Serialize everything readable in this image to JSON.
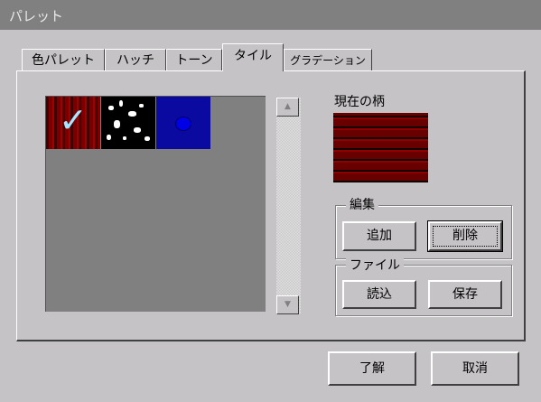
{
  "window": {
    "title": "パレット"
  },
  "tabs": [
    {
      "label": "色パレット"
    },
    {
      "label": "ハッチ"
    },
    {
      "label": "トーン"
    },
    {
      "label": "タイル",
      "active": true
    },
    {
      "label": "グラデーション"
    }
  ],
  "tiles": [
    {
      "name": "red-brick-tile",
      "selected": true
    },
    {
      "name": "black-white-speckle-tile",
      "selected": false
    },
    {
      "name": "blue-dot-tile",
      "selected": false
    }
  ],
  "current_pattern": {
    "label": "現在の柄"
  },
  "edit_group": {
    "label": "編集",
    "add_label": "追加",
    "delete_label": "削除"
  },
  "file_group": {
    "label": "ファイル",
    "load_label": "読込",
    "save_label": "保存"
  },
  "footer": {
    "ok_label": "了解",
    "cancel_label": "取消"
  },
  "icons": {
    "scroll_up": "up-arrow-icon",
    "scroll_down": "down-arrow-icon",
    "check": "checkmark-icon"
  }
}
